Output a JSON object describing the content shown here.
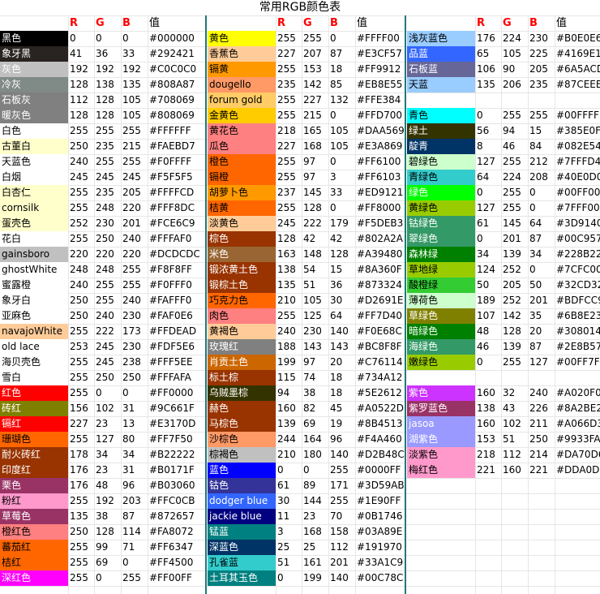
{
  "title": "常用RGB颜色表",
  "headers": {
    "r": "R",
    "g": "G",
    "b": "B",
    "hex": "值"
  },
  "blocks": [
    {
      "rows": [
        {
          "name": "黑色",
          "r": "0",
          "g": "0",
          "b": "0",
          "hex": "#000000",
          "bg": "#000000",
          "fg": "#ffffff"
        },
        {
          "name": "象牙黑",
          "r": "41",
          "g": "36",
          "b": "33",
          "hex": "#292421",
          "bg": "#292421",
          "fg": "#ffffff"
        },
        {
          "name": "灰色",
          "r": "192",
          "g": "192",
          "b": "192",
          "hex": "#C0C0C0",
          "bg": "#c0c0c0",
          "fg": "#ffffff"
        },
        {
          "name": "冷灰",
          "r": "128",
          "g": "138",
          "b": "135",
          "hex": "#808A87",
          "bg": "#808a87",
          "fg": "#ffffff"
        },
        {
          "name": "石板灰",
          "r": "112",
          "g": "128",
          "b": "105",
          "hex": "#708069",
          "bg": "#808080",
          "fg": "#ffffff"
        },
        {
          "name": "暖灰色",
          "r": "128",
          "g": "128",
          "b": "105",
          "hex": "#808069",
          "bg": "#808080",
          "fg": "#ffffff"
        },
        {
          "name": "白色",
          "r": "255",
          "g": "255",
          "b": "255",
          "hex": "#FFFFFF",
          "bg": "#ffffff",
          "fg": "#000000"
        },
        {
          "name": "古董白",
          "r": "250",
          "g": "235",
          "b": "215",
          "hex": "#FAEBD7",
          "bg": "#ffffcc",
          "fg": "#000000"
        },
        {
          "name": "天蓝色",
          "r": "240",
          "g": "255",
          "b": "255",
          "hex": "#F0FFFF",
          "bg": "#ffffff",
          "fg": "#000000"
        },
        {
          "name": "白烟",
          "r": "245",
          "g": "245",
          "b": "245",
          "hex": "#F5F5F5",
          "bg": "#ffffff",
          "fg": "#000000"
        },
        {
          "name": "白杏仁",
          "r": "255",
          "g": "235",
          "b": "205",
          "hex": "#FFFFCD",
          "bg": "#ffffcc",
          "fg": "#000000"
        },
        {
          "name": "cornsilk",
          "r": "255",
          "g": "248",
          "b": "220",
          "hex": "#FFF8DC",
          "bg": "#ffffcc",
          "fg": "#000000"
        },
        {
          "name": "蛋壳色",
          "r": "252",
          "g": "230",
          "b": "201",
          "hex": "#FCE6C9",
          "bg": "#ffffcc",
          "fg": "#000000"
        },
        {
          "name": "花白",
          "r": "255",
          "g": "250",
          "b": "240",
          "hex": "#FFFAF0",
          "bg": "#ffffff",
          "fg": "#000000"
        },
        {
          "name": "gainsboro",
          "r": "220",
          "g": "220",
          "b": "220",
          "hex": "#DCDCDC",
          "bg": "#c0c0c0",
          "fg": "#000000"
        },
        {
          "name": "ghostWhite",
          "r": "248",
          "g": "248",
          "b": "255",
          "hex": "#F8F8FF",
          "bg": "#ffffff",
          "fg": "#000000"
        },
        {
          "name": "蜜露橙",
          "r": "240",
          "g": "255",
          "b": "255",
          "hex": "#F0FFF0",
          "bg": "#ffffff",
          "fg": "#000000"
        },
        {
          "name": "象牙白",
          "r": "250",
          "g": "255",
          "b": "240",
          "hex": "#FAFFF0",
          "bg": "#ffffff",
          "fg": "#000000"
        },
        {
          "name": "亚麻色",
          "r": "250",
          "g": "240",
          "b": "230",
          "hex": "#FAF0E6",
          "bg": "#ffffff",
          "fg": "#000000"
        },
        {
          "name": "navajoWhite",
          "r": "255",
          "g": "222",
          "b": "173",
          "hex": "#FFDEAD",
          "bg": "#ffcc99",
          "fg": "#000000"
        },
        {
          "name": "old lace",
          "r": "253",
          "g": "245",
          "b": "230",
          "hex": "#FDF5E6",
          "bg": "#ffffff",
          "fg": "#000000"
        },
        {
          "name": "海贝壳色",
          "r": "255",
          "g": "245",
          "b": "238",
          "hex": "#FFF5EE",
          "bg": "#ffffff",
          "fg": "#000000"
        },
        {
          "name": "雪白",
          "r": "255",
          "g": "250",
          "b": "250",
          "hex": "#FFFAFA",
          "bg": "#ffffff",
          "fg": "#000000"
        },
        {
          "name": "红色",
          "r": "255",
          "g": "0",
          "b": "0",
          "hex": "#FF0000",
          "bg": "#ff0000",
          "fg": "#ffffff"
        },
        {
          "name": "砖红",
          "r": "156",
          "g": "102",
          "b": "31",
          "hex": "#9C661F",
          "bg": "#808000",
          "fg": "#ffffff"
        },
        {
          "name": "镉红",
          "r": "227",
          "g": "23",
          "b": "13",
          "hex": "#E3170D",
          "bg": "#ff0000",
          "fg": "#ffffff"
        },
        {
          "name": "珊瑚色",
          "r": "255",
          "g": "127",
          "b": "80",
          "hex": "#FF7F50",
          "bg": "#ff6600",
          "fg": "#000000"
        },
        {
          "name": "耐火砖红",
          "r": "178",
          "g": "34",
          "b": "34",
          "hex": "#B22222",
          "bg": "#993300",
          "fg": "#ffffff"
        },
        {
          "name": "印度红",
          "r": "176",
          "g": "23",
          "b": "31",
          "hex": "#B0171F",
          "bg": "#993300",
          "fg": "#ffffff"
        },
        {
          "name": "栗色",
          "r": "176",
          "g": "48",
          "b": "96",
          "hex": "#B03060",
          "bg": "#993366",
          "fg": "#ffffff"
        },
        {
          "name": "粉红",
          "r": "255",
          "g": "192",
          "b": "203",
          "hex": "#FFC0CB",
          "bg": "#ff99cc",
          "fg": "#000000"
        },
        {
          "name": "草莓色",
          "r": "135",
          "g": "38",
          "b": "87",
          "hex": "#872657",
          "bg": "#993366",
          "fg": "#ffffff"
        },
        {
          "name": "橙红色",
          "r": "250",
          "g": "128",
          "b": "114",
          "hex": "#FA8072",
          "bg": "#ff8080",
          "fg": "#000000"
        },
        {
          "name": "蕃茄红",
          "r": "255",
          "g": "99",
          "b": "71",
          "hex": "#FF6347",
          "bg": "#ff6600",
          "fg": "#000000"
        },
        {
          "name": "桔红",
          "r": "255",
          "g": "69",
          "b": "0",
          "hex": "#FF4500",
          "bg": "#ff6600",
          "fg": "#000000"
        },
        {
          "name": "深红色",
          "r": "255",
          "g": "0",
          "b": "255",
          "hex": "#FF00FF",
          "bg": "#ff00ff",
          "fg": "#ffffff"
        }
      ]
    },
    {
      "rows": [
        {
          "name": "黄色",
          "r": "255",
          "g": "255",
          "b": "0",
          "hex": "#FFFF00",
          "bg": "#ffff00",
          "fg": "#000000"
        },
        {
          "name": "香蕉色",
          "r": "227",
          "g": "207",
          "b": "87",
          "hex": "#E3CF57",
          "bg": "#ffcc99",
          "fg": "#000000"
        },
        {
          "name": "镉黄",
          "r": "255",
          "g": "153",
          "b": "18",
          "hex": "#FF9912",
          "bg": "#ff9900",
          "fg": "#000000"
        },
        {
          "name": "dougello",
          "r": "235",
          "g": "142",
          "b": "85",
          "hex": "#EB8E55",
          "bg": "#ff9966",
          "fg": "#000000"
        },
        {
          "name": "forum gold",
          "r": "255",
          "g": "227",
          "b": "132",
          "hex": "#FFE384",
          "bg": "#ffcc66",
          "fg": "#000000"
        },
        {
          "name": "金黄色",
          "r": "255",
          "g": "215",
          "b": "0",
          "hex": "#FFD700",
          "bg": "#ffcc00",
          "fg": "#000000"
        },
        {
          "name": "黄花色",
          "r": "218",
          "g": "165",
          "b": "105",
          "hex": "#DAA569",
          "bg": "#ff8080",
          "fg": "#000000"
        },
        {
          "name": "瓜色",
          "r": "227",
          "g": "168",
          "b": "105",
          "hex": "#E3A869",
          "bg": "#ff8080",
          "fg": "#000000"
        },
        {
          "name": "橙色",
          "r": "255",
          "g": "97",
          "b": "0",
          "hex": "#FF6100",
          "bg": "#ff6600",
          "fg": "#000000"
        },
        {
          "name": "镉橙",
          "r": "255",
          "g": "97",
          "b": "3",
          "hex": "#FF6103",
          "bg": "#ff6600",
          "fg": "#000000"
        },
        {
          "name": "胡萝卜色",
          "r": "237",
          "g": "145",
          "b": "33",
          "hex": "#ED9121",
          "bg": "#ff9900",
          "fg": "#000000"
        },
        {
          "name": "桔黄",
          "r": "255",
          "g": "128",
          "b": "0",
          "hex": "#FF8000",
          "bg": "#ff6600",
          "fg": "#000000"
        },
        {
          "name": "淡黄色",
          "r": "245",
          "g": "222",
          "b": "179",
          "hex": "#F5DEB3",
          "bg": "#ffcc99",
          "fg": "#000000"
        },
        {
          "name": "棕色",
          "r": "128",
          "g": "42",
          "b": "42",
          "hex": "#802A2A",
          "bg": "#993300",
          "fg": "#ffffff"
        },
        {
          "name": "米色",
          "r": "163",
          "g": "148",
          "b": "128",
          "hex": "#A39480",
          "bg": "#996633",
          "fg": "#ffffff"
        },
        {
          "name": "锻浓黄土色",
          "r": "138",
          "g": "54",
          "b": "15",
          "hex": "#8A360F",
          "bg": "#993300",
          "fg": "#ffffff"
        },
        {
          "name": "锻棕土色",
          "r": "135",
          "g": "51",
          "b": "36",
          "hex": "#873324",
          "bg": "#993300",
          "fg": "#ffffff"
        },
        {
          "name": "巧克力色",
          "r": "210",
          "g": "105",
          "b": "30",
          "hex": "#D2691E",
          "bg": "#ff6600",
          "fg": "#000000"
        },
        {
          "name": "肉色",
          "r": "255",
          "g": "125",
          "b": "64",
          "hex": "#FF7D40",
          "bg": "#ff8080",
          "fg": "#000000"
        },
        {
          "name": "黄褐色",
          "r": "240",
          "g": "230",
          "b": "140",
          "hex": "#F0E68C",
          "bg": "#ffcc99",
          "fg": "#000000"
        },
        {
          "name": "玫瑰红",
          "r": "188",
          "g": "143",
          "b": "143",
          "hex": "#BC8F8F",
          "bg": "#808080",
          "fg": "#ffffff"
        },
        {
          "name": "肖贡土色",
          "r": "199",
          "g": "97",
          "b": "20",
          "hex": "#C76114",
          "bg": "#cc6600",
          "fg": "#ffffff"
        },
        {
          "name": "标土棕",
          "r": "115",
          "g": "74",
          "b": "18",
          "hex": "#734A12",
          "bg": "#993300",
          "fg": "#ffffff"
        },
        {
          "name": "乌贼墨棕",
          "r": "94",
          "g": "38",
          "b": "18",
          "hex": "#5E2612",
          "bg": "#333300",
          "fg": "#ffffff"
        },
        {
          "name": "赫色",
          "r": "160",
          "g": "82",
          "b": "45",
          "hex": "#A0522D",
          "bg": "#993300",
          "fg": "#ffffff"
        },
        {
          "name": "马棕色",
          "r": "139",
          "g": "69",
          "b": "19",
          "hex": "#8B4513",
          "bg": "#993300",
          "fg": "#ffffff"
        },
        {
          "name": "沙棕色",
          "r": "244",
          "g": "164",
          "b": "96",
          "hex": "#F4A460",
          "bg": "#ff9966",
          "fg": "#000000"
        },
        {
          "name": "棕褐色",
          "r": "210",
          "g": "180",
          "b": "140",
          "hex": "#D2B48C",
          "bg": "#c0c0c0",
          "fg": "#000000"
        },
        {
          "name": "蓝色",
          "r": "0",
          "g": "0",
          "b": "255",
          "hex": "#0000FF",
          "bg": "#0000ff",
          "fg": "#ffffff"
        },
        {
          "name": "钴色",
          "r": "61",
          "g": "89",
          "b": "171",
          "hex": "#3D59AB",
          "bg": "#333399",
          "fg": "#ffffff"
        },
        {
          "name": "dodger blue",
          "r": "30",
          "g": "144",
          "b": "255",
          "hex": "#1E90FF",
          "bg": "#3366ff",
          "fg": "#ffffff"
        },
        {
          "name": "jackie blue",
          "r": "11",
          "g": "23",
          "b": "70",
          "hex": "#0B1746",
          "bg": "#000080",
          "fg": "#ffffff"
        },
        {
          "name": "锰蓝",
          "r": "3",
          "g": "168",
          "b": "158",
          "hex": "#03A89E",
          "bg": "#008080",
          "fg": "#ffffff"
        },
        {
          "name": "深蓝色",
          "r": "25",
          "g": "25",
          "b": "112",
          "hex": "#191970",
          "bg": "#003366",
          "fg": "#ffffff"
        },
        {
          "name": "孔雀蓝",
          "r": "51",
          "g": "161",
          "b": "201",
          "hex": "#33A1C9",
          "bg": "#33cccc",
          "fg": "#000000"
        },
        {
          "name": "土耳其玉色",
          "r": "0",
          "g": "199",
          "b": "140",
          "hex": "#00C78C",
          "bg": "#008080",
          "fg": "#ffffff"
        }
      ]
    },
    {
      "rows": [
        {
          "name": "浅灰蓝色",
          "r": "176",
          "g": "224",
          "b": "230",
          "hex": "#B0E0E6",
          "bg": "#99ccff",
          "fg": "#000000"
        },
        {
          "name": "品蓝",
          "r": "65",
          "g": "105",
          "b": "225",
          "hex": "#4169E1",
          "bg": "#3366ff",
          "fg": "#ffffff"
        },
        {
          "name": "石板蓝",
          "r": "106",
          "g": "90",
          "b": "205",
          "hex": "#6A5ACD",
          "bg": "#666699",
          "fg": "#ffffff"
        },
        {
          "name": "天蓝",
          "r": "135",
          "g": "206",
          "b": "235",
          "hex": "#87CEEB",
          "bg": "#99ccff",
          "fg": "#000000"
        },
        {
          "name": "",
          "r": "",
          "g": "",
          "b": "",
          "hex": "",
          "bg": "",
          "fg": "#000000"
        },
        {
          "name": "青色",
          "r": "0",
          "g": "255",
          "b": "255",
          "hex": "#00FFFF",
          "bg": "#00ffff",
          "fg": "#000000"
        },
        {
          "name": "绿土",
          "r": "56",
          "g": "94",
          "b": "15",
          "hex": "#385E0F",
          "bg": "#333300",
          "fg": "#ffffff"
        },
        {
          "name": "靛青",
          "r": "8",
          "g": "46",
          "b": "84",
          "hex": "#082E54",
          "bg": "#003366",
          "fg": "#ffffff"
        },
        {
          "name": "碧绿色",
          "r": "127",
          "g": "255",
          "b": "212",
          "hex": "#7FFFD4",
          "bg": "#ccffcc",
          "fg": "#000000"
        },
        {
          "name": "青绿色",
          "r": "64",
          "g": "224",
          "b": "208",
          "hex": "#40E0D0",
          "bg": "#33cccc",
          "fg": "#000000"
        },
        {
          "name": "绿色",
          "r": "0",
          "g": "255",
          "b": "0",
          "hex": "#00FF00",
          "bg": "#00ff00",
          "fg": "#ffffff"
        },
        {
          "name": "黄绿色",
          "r": "127",
          "g": "255",
          "b": "0",
          "hex": "#7FFF00",
          "bg": "#99cc00",
          "fg": "#000000"
        },
        {
          "name": "钴绿色",
          "r": "61",
          "g": "145",
          "b": "64",
          "hex": "#3D9140",
          "bg": "#339966",
          "fg": "#ffffff"
        },
        {
          "name": "翠绿色",
          "r": "0",
          "g": "201",
          "b": "87",
          "hex": "#00C957",
          "bg": "#339966",
          "fg": "#ffffff"
        },
        {
          "name": "森林绿",
          "r": "34",
          "g": "139",
          "b": "34",
          "hex": "#228B22",
          "bg": "#008000",
          "fg": "#ffffff"
        },
        {
          "name": "草地绿",
          "r": "124",
          "g": "252",
          "b": "0",
          "hex": "#7CFC00",
          "bg": "#99cc00",
          "fg": "#000000"
        },
        {
          "name": "酸橙绿",
          "r": "50",
          "g": "205",
          "b": "50",
          "hex": "#32CD32",
          "bg": "#33cc33",
          "fg": "#000000"
        },
        {
          "name": "薄荷色",
          "r": "189",
          "g": "252",
          "b": "201",
          "hex": "#BDFCC9",
          "bg": "#ccffcc",
          "fg": "#000000"
        },
        {
          "name": "草绿色",
          "r": "107",
          "g": "142",
          "b": "35",
          "hex": "#6B8E23",
          "bg": "#808000",
          "fg": "#ffffff"
        },
        {
          "name": "暗绿色",
          "r": "48",
          "g": "128",
          "b": "20",
          "hex": "#308014",
          "bg": "#008000",
          "fg": "#ffffff"
        },
        {
          "name": "海绿色",
          "r": "46",
          "g": "139",
          "b": "87",
          "hex": "#2E8B57",
          "bg": "#339966",
          "fg": "#ffffff"
        },
        {
          "name": "嫩绿色",
          "r": "0",
          "g": "255",
          "b": "127",
          "hex": "#00FF7F",
          "bg": "#99cc00",
          "fg": "#000000"
        },
        {
          "name": "",
          "r": "",
          "g": "",
          "b": "",
          "hex": "",
          "bg": "",
          "fg": "#000000"
        },
        {
          "name": "紫色",
          "r": "160",
          "g": "32",
          "b": "240",
          "hex": "#A020F0",
          "bg": "#cc33ff",
          "fg": "#ffffff"
        },
        {
          "name": "紫罗蓝色",
          "r": "138",
          "g": "43",
          "b": "226",
          "hex": "#8A2BE2",
          "bg": "#993366",
          "fg": "#ffffff"
        },
        {
          "name": "jasoa",
          "r": "160",
          "g": "102",
          "b": "211",
          "hex": "#A066D3",
          "bg": "#9999ff",
          "fg": "#ffffff"
        },
        {
          "name": "湖紫色",
          "r": "153",
          "g": "51",
          "b": "250",
          "hex": "#9933FA",
          "bg": "#9999ff",
          "fg": "#ffffff"
        },
        {
          "name": "淡紫色",
          "r": "218",
          "g": "112",
          "b": "214",
          "hex": "#DA70D6",
          "bg": "#ff99cc",
          "fg": "#000000"
        },
        {
          "name": "梅红色",
          "r": "221",
          "g": "160",
          "b": "221",
          "hex": "#DDA0DD",
          "bg": "#ff99cc",
          "fg": "#000000"
        }
      ]
    }
  ]
}
